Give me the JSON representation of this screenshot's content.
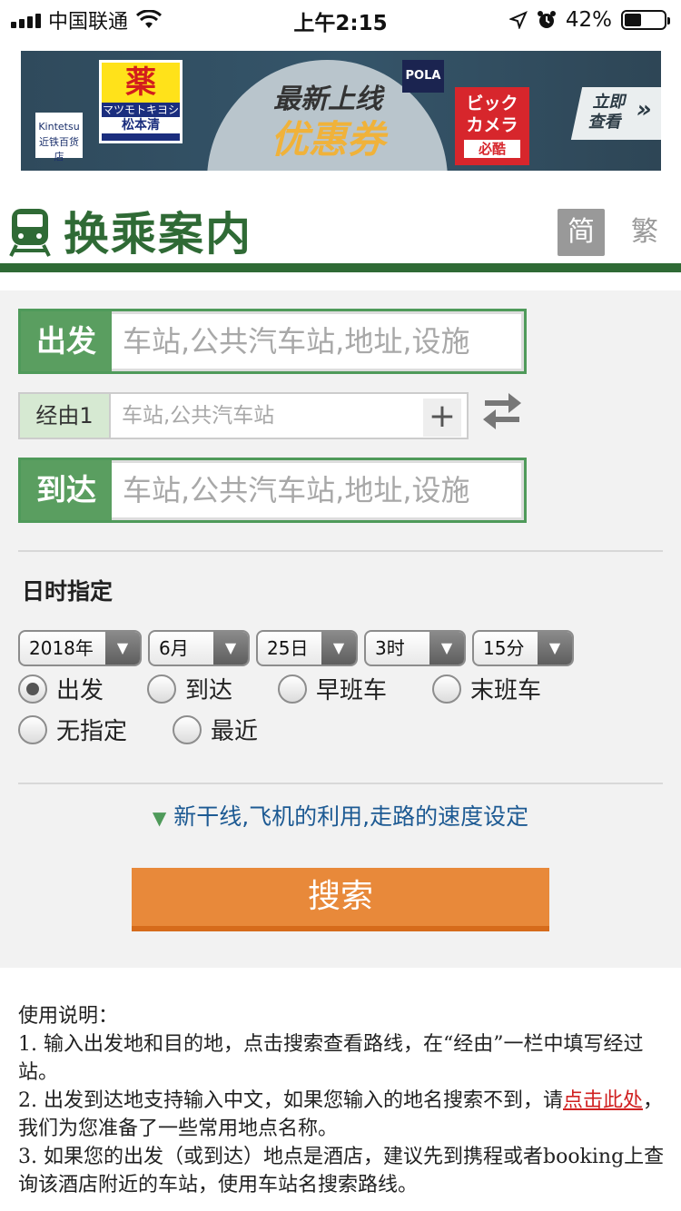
{
  "status_bar": {
    "carrier": "中国联通",
    "time": "上午2:15",
    "battery_percent": "42%",
    "battery_level": 0.42
  },
  "banner": {
    "kintetsu_logo": "Kintetsu",
    "kintetsu_sub": "近铁百货店",
    "mk_big": "薬",
    "mk_sub": "マツモトキヨシ",
    "mk_name": "松本清",
    "title_line1": "最新上线",
    "title_line2": "优惠券",
    "pola": "POLA",
    "bic_line1": "ビック",
    "bic_line2": "カメラ",
    "bic_line3": "必酷",
    "cta_line1": "立即",
    "cta_line2": "查看",
    "cta_arrows": "»"
  },
  "header": {
    "title": "换乘案内",
    "lang_simplified": "简",
    "lang_traditional": "繁"
  },
  "form": {
    "departure": {
      "label": "出发",
      "placeholder": "车站,公共汽车站,地址,设施"
    },
    "via": {
      "label": "经由1",
      "placeholder": "车站,公共汽车站",
      "add": "+"
    },
    "arrival": {
      "label": "到达",
      "placeholder": "车站,公共汽车站,地址,设施"
    },
    "datetime_title": "日时指定",
    "selects": [
      {
        "value": "2018年"
      },
      {
        "value": "6月"
      },
      {
        "value": "25日"
      },
      {
        "value": "3时"
      },
      {
        "value": "15分"
      }
    ],
    "radios": [
      {
        "label": "出发",
        "checked": true
      },
      {
        "label": "到达",
        "checked": false
      },
      {
        "label": "早班车",
        "checked": false
      },
      {
        "label": "末班车",
        "checked": false
      },
      {
        "label": "无指定",
        "checked": false
      },
      {
        "label": "最近",
        "checked": false
      }
    ],
    "advanced_link": "新干线,飞机的利用,走路的速度设定",
    "search_button": "搜索"
  },
  "instructions": {
    "title": "使用说明：",
    "item1": "1. 输入出发地和目的地，点击搜索查看路线，在“经由”一栏中填写经过站。",
    "item2_before": "2. 出发到达地支持输入中文，如果您输入的地名搜索不到，请",
    "item2_link": "点击此处",
    "item2_after": "，我们为您准备了一些常用地点名称。",
    "item3": "3. 如果您的出发（或到达）地点是酒店，建议先到携程或者booking上查询该酒店附近的车站，使用车站名搜索路线。"
  }
}
